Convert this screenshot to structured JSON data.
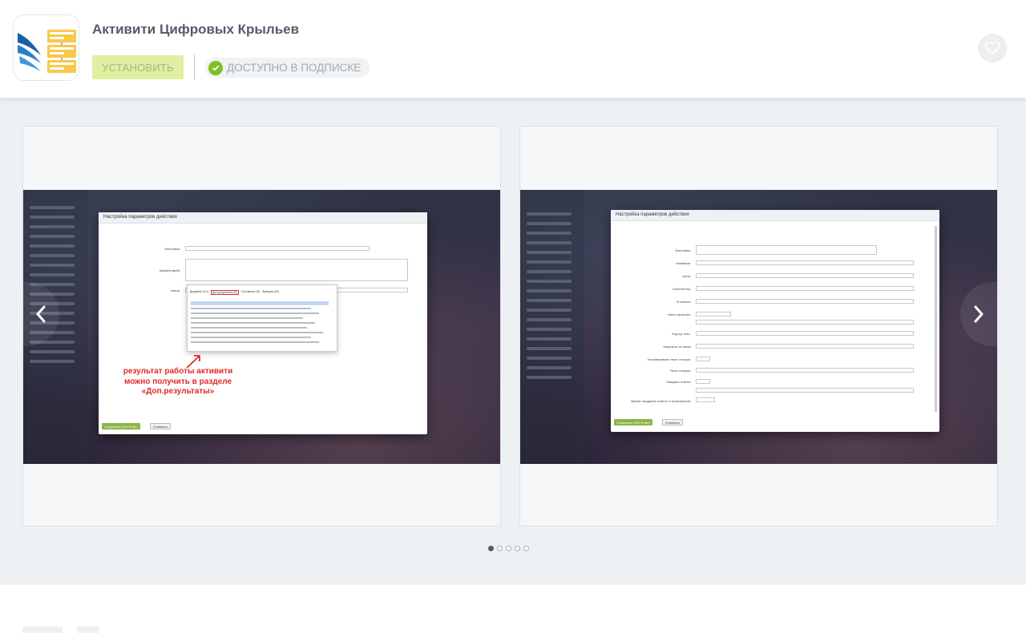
{
  "app": {
    "title": "Активити Цифровых Крыльев",
    "icon": "wings-logo-icon"
  },
  "actions": {
    "install_label": "УСТАНОВИТЬ",
    "subscription_label": "ДОСТУПНО В ПОДПИСКЕ",
    "favorite_icon": "heart-icon"
  },
  "gallery": {
    "slides": [
      {
        "dialog_title": "Настройка параметров действия",
        "fields": [
          "Заголовок:",
          "Комментарий:",
          "Автор:"
        ],
        "tabs": [
          "Документ (Ст)",
          "Доп.результаты (9)",
          "Составные (8)",
          "Функции (43)"
        ],
        "annotation": "результат работы активити можно получить в разделе «Доп.результаты»",
        "save_label": "Сохранить (Ctrl+Enter)",
        "cancel_label": "Отменить"
      },
      {
        "dialog_title": "Настройка параметров действия",
        "fields": [
          "Заголовок:",
          "Название:",
          "Цена:",
          "Количество:",
          "% налога:",
          "Налог включён:",
          "Код ед. изм.:",
          "Загрузить из пачки",
          "Устанавливать текст статуса:",
          "Текст статуса:",
          "Ожидать ответа:",
          "Время ожидания ответа от приложения:"
        ],
        "save_label": "Сохранить (Ctrl+Enter)",
        "cancel_label": "Отменить"
      }
    ],
    "dots_total": 5,
    "active_dot": 1
  },
  "colors": {
    "install_bg": "#dff0a1",
    "check_green": "#7ec122",
    "annotation_red": "#e02a26",
    "title_text": "#535c69"
  }
}
